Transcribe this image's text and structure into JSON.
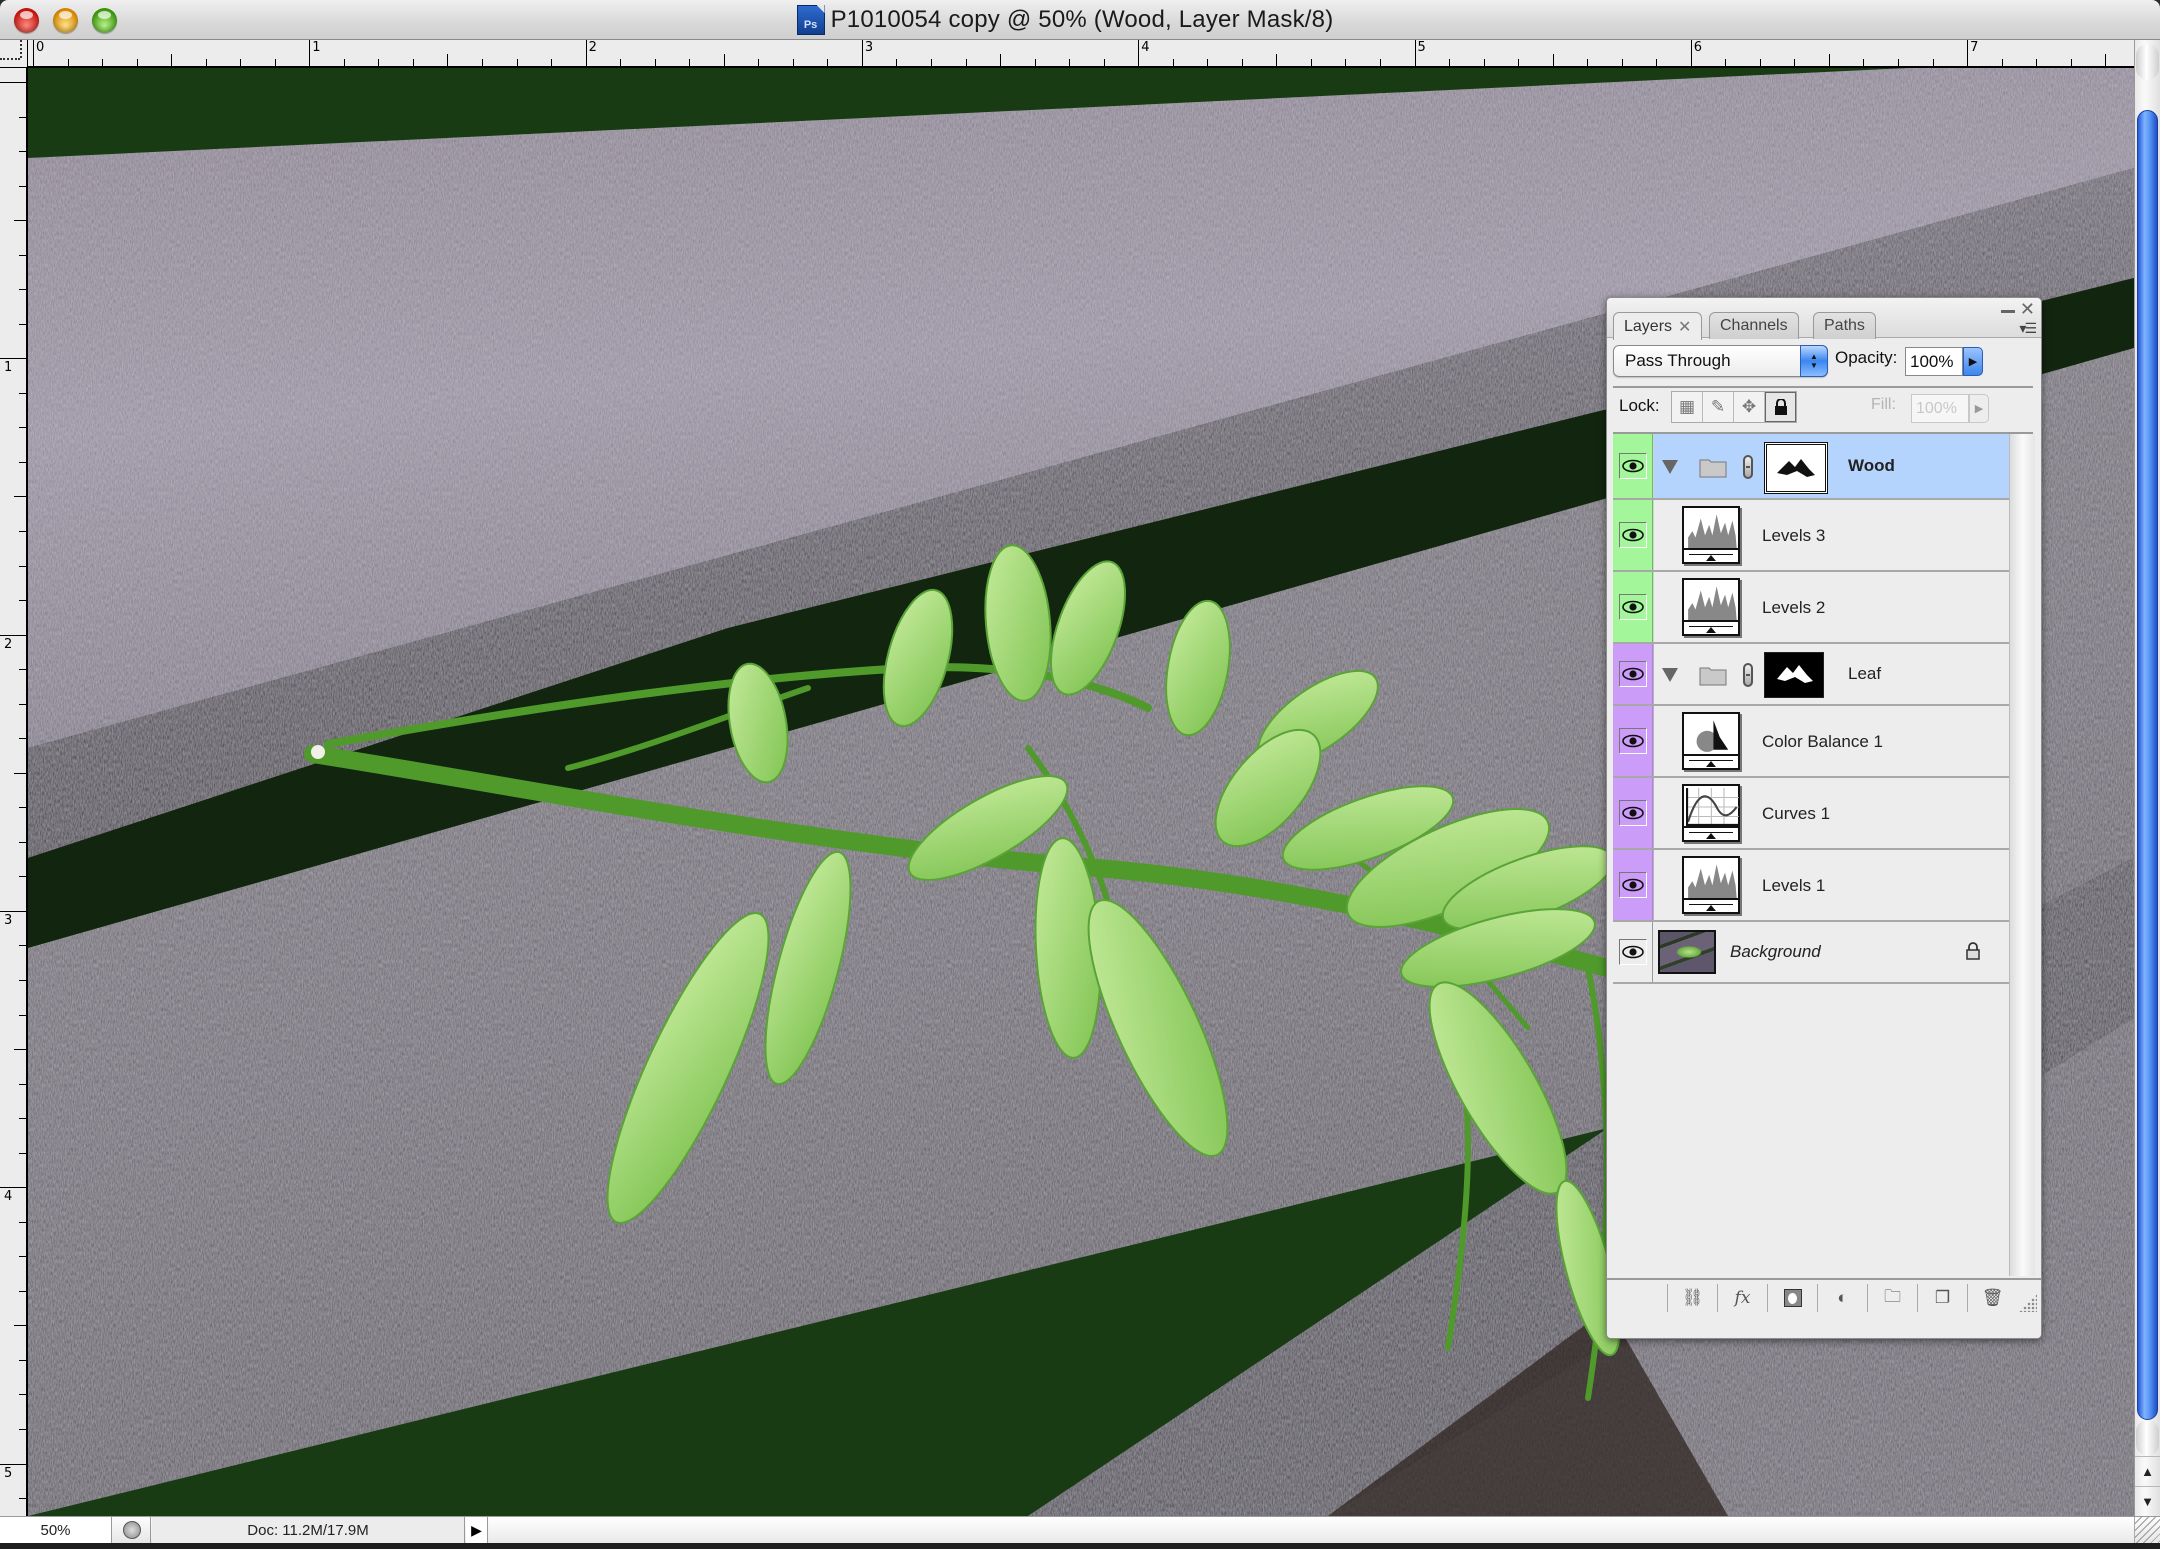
{
  "window": {
    "title": "P1010054 copy @ 50% (Wood, Layer Mask/8)",
    "app_icon": "photoshop-document-icon",
    "buttons": [
      "close",
      "minimize",
      "zoom"
    ]
  },
  "rulers": {
    "unit": "inches",
    "top_labels": [
      "0",
      "1",
      "2",
      "3",
      "4",
      "5",
      "6",
      "7"
    ],
    "left_labels": [
      "1",
      "2",
      "3",
      "4",
      "5"
    ]
  },
  "canvas": {
    "description": "Photo of green leaves resting on weathered gray wooden bench slats, green foliage background"
  },
  "status_bar": {
    "zoom": "50%",
    "doc_info": "Doc: 11.2M/17.9M",
    "arrow": "▶"
  },
  "layers_panel": {
    "tabs": [
      {
        "label": "Layers",
        "active": true,
        "closable": true
      },
      {
        "label": "Channels",
        "active": false
      },
      {
        "label": "Paths",
        "active": false
      }
    ],
    "blend_mode": "Pass Through",
    "opacity_label": "Opacity:",
    "opacity_value": "100%",
    "lock_label": "Lock:",
    "lock_icons": [
      "lock-transparent-icon",
      "lock-image-icon",
      "lock-position-icon",
      "lock-all-icon"
    ],
    "fill_label": "Fill:",
    "fill_value": "100%",
    "colors": {
      "wood_group": "#a3f79a",
      "leaf_group": "#cc9cf9",
      "selected_row": "#b5d4fd"
    },
    "layers": [
      {
        "name": "Wood",
        "type": "group",
        "expanded": true,
        "visible": true,
        "selected": true,
        "color": "green",
        "mask": "white"
      },
      {
        "name": "Levels 3",
        "type": "levels",
        "visible": true,
        "color": "green"
      },
      {
        "name": "Levels 2",
        "type": "levels",
        "visible": true,
        "color": "green"
      },
      {
        "name": "Leaf",
        "type": "group",
        "expanded": true,
        "visible": true,
        "color": "violet",
        "mask": "black"
      },
      {
        "name": "Color Balance 1",
        "type": "color-balance",
        "visible": true,
        "color": "violet"
      },
      {
        "name": "Curves 1",
        "type": "curves",
        "visible": true,
        "color": "violet"
      },
      {
        "name": "Levels 1",
        "type": "levels",
        "visible": true,
        "color": "violet"
      },
      {
        "name": "Background",
        "type": "background",
        "visible": true,
        "locked": true
      }
    ],
    "bottom_buttons": [
      "link-layers",
      "layer-style-fx",
      "add-mask",
      "new-adjustment-layer",
      "new-group",
      "new-layer",
      "delete-layer"
    ],
    "fx_label": "fx"
  }
}
